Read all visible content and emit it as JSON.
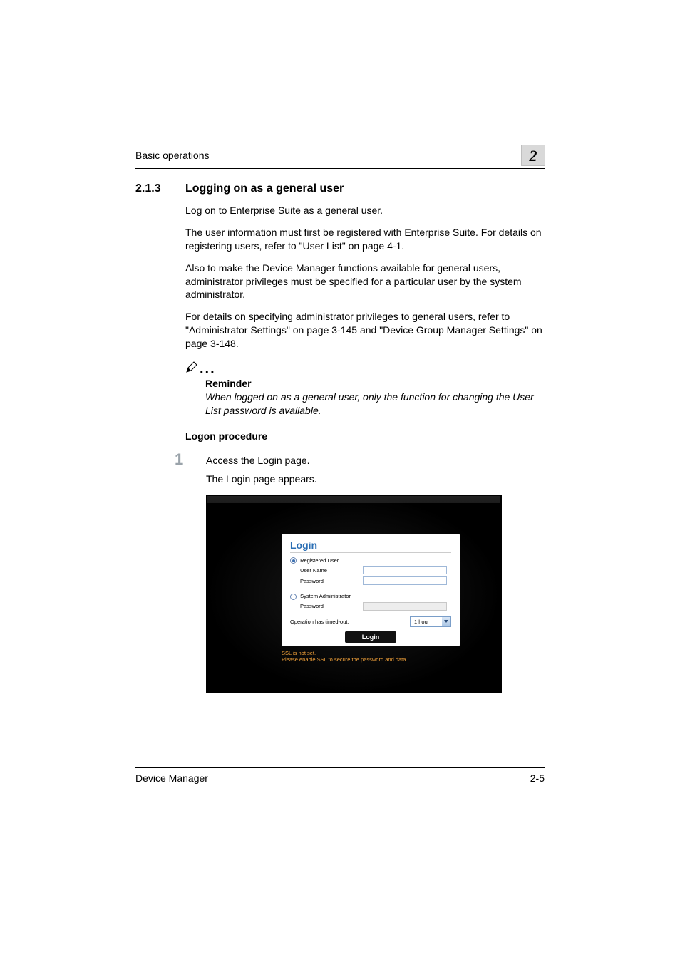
{
  "header": {
    "running": "Basic operations",
    "chapter": "2"
  },
  "section": {
    "number": "2.1.3",
    "title": "Logging on as a general user"
  },
  "paragraphs": {
    "p1": "Log on to Enterprise Suite as a general user.",
    "p2": "The user information must first be registered with Enterprise Suite. For details on registering users, refer to \"User List\" on page 4-1.",
    "p3": "Also to make the Device Manager functions available for general users, administrator privileges must be specified for a particular user by the system administrator.",
    "p4": "For details on specifying administrator privileges to general users, refer to \"Administrator Settings\" on page 3-145 and \"Device Group Manager Settings\" on page 3-148."
  },
  "reminder": {
    "label": "Reminder",
    "body": "When logged on as a general user, only the function for changing the User List password is available."
  },
  "subhead": "Logon procedure",
  "steps": {
    "s1_num": "1",
    "s1_text": "Access the Login page.",
    "s1_follow": "The Login page appears."
  },
  "login_panel": {
    "title": "Login",
    "reg_user_label": "Registered User",
    "username_label": "User Name",
    "password_label": "Password",
    "sysadmin_label": "System Administrator",
    "sysadmin_pw_label": "Password",
    "timeout_label": "Operation has timed-out.",
    "timeout_value": "1 hour",
    "login_button": "Login",
    "ssl_line1": "SSL is not set.",
    "ssl_line2": "Please enable SSL to secure the password and data."
  },
  "footer": {
    "left": "Device Manager",
    "right": "2-5"
  }
}
